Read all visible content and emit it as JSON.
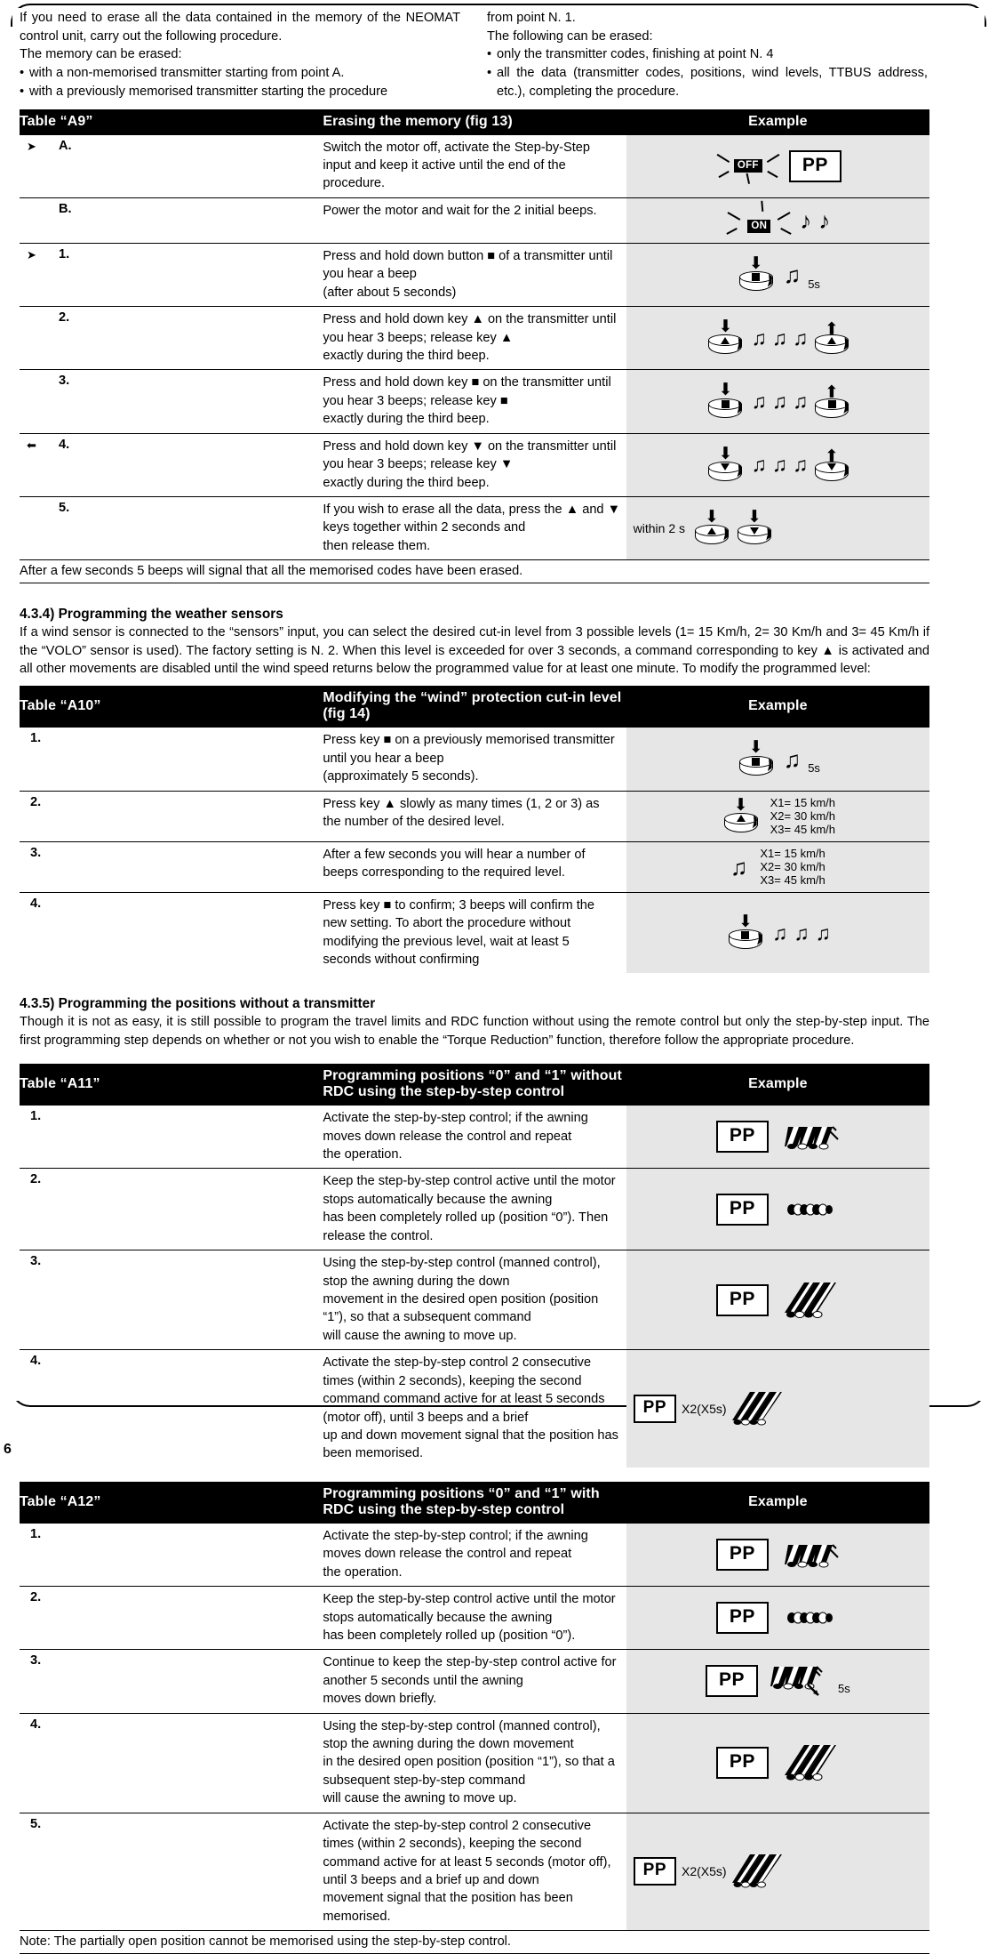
{
  "intro": {
    "left": {
      "p1": "If you need to erase all the data contained in the memory of the NEOMAT control unit, carry out the following procedure.",
      "p2": "The memory can be erased:",
      "b1": "with a non-memorised transmitter starting from point A.",
      "b2": "with a previously memorised transmitter starting the procedure"
    },
    "right": {
      "p1": "from point N. 1.",
      "p2": "The following can be erased:",
      "b1": "only the transmitter codes, finishing at point N. 4",
      "b2": "all the data (transmitter codes, positions, wind levels, TTBUS address, etc.), completing the procedure."
    }
  },
  "tableA9": {
    "label": "Table “A9”",
    "title": "Erasing the memory (fig 13)",
    "example": "Example",
    "rows": [
      {
        "num": "A.",
        "marker": "right",
        "desc": "Switch the motor off, activate the Step-by-Step input and keep it active until the end of the procedure.",
        "example": {
          "kind": "lamp-pp",
          "lamp": "OFF",
          "pp": "PP"
        }
      },
      {
        "num": "B.",
        "marker": "",
        "desc": "Power the motor and wait for the 2 initial beeps.",
        "example": {
          "kind": "lamp-beeps",
          "lamp": "ON",
          "beeps": 2
        }
      },
      {
        "num": "1.",
        "marker": "right",
        "desc": "Press and hold down button ■ of a transmitter until you hear a beep",
        "desc2": "(after about 5 seconds)",
        "example": {
          "kind": "btn-beeps",
          "glyph": "square",
          "beeps": 1,
          "note": "5s"
        }
      },
      {
        "num": "2.",
        "marker": "",
        "desc": "Press and hold down key ▲ on the transmitter until you hear 3 beeps; release key ▲",
        "desc2": "exactly during the third beep.",
        "example": {
          "kind": "btn-beeps-release",
          "glyph": "up",
          "beeps": 3,
          "release": "up"
        }
      },
      {
        "num": "3.",
        "marker": "",
        "desc": "Press and hold down key ■ on the transmitter until you hear 3 beeps; release key ■",
        "desc2": "exactly during the third beep.",
        "example": {
          "kind": "btn-beeps-release",
          "glyph": "square",
          "beeps": 3,
          "release": "square"
        }
      },
      {
        "num": "4.",
        "marker": "left",
        "desc": "Press and hold down key ▼ on the transmitter until you hear 3 beeps; release key ▼",
        "desc2": "exactly during the third beep.",
        "example": {
          "kind": "btn-beeps-release",
          "glyph": "down",
          "beeps": 3,
          "release": "down"
        }
      },
      {
        "num": "5.",
        "marker": "",
        "desc": "If you wish to erase all the data, press the  ▲ and ▼ keys together within 2 seconds and",
        "desc2": "then release them.",
        "example": {
          "kind": "two-buttons",
          "label": "within 2 s",
          "glyphs": [
            "up",
            "down"
          ]
        }
      }
    ],
    "footnote": "After a few seconds 5 beeps will signal that all the memorised codes have been erased."
  },
  "section434": {
    "heading": "4.3.4) Programming the weather sensors",
    "body": "If a wind sensor is connected to the “sensors” input, you can select the desired cut-in level from 3 possible levels (1= 15 Km/h, 2= 30 Km/h and 3= 45 Km/h if the “VOLO” sensor is used). The factory setting is N. 2. When this level is exceeded for over 3 seconds, a command corresponding to key ▲ is activated and all other movements are disabled until the wind speed returns below the programmed value for at least one minute. To modify the programmed level:"
  },
  "tableA10": {
    "label": "Table “A10”",
    "title": "Modifying the “wind” protection cut-in level  (fig 14)",
    "example": "Example",
    "levels": [
      "X1= 15 km/h",
      "X2= 30 km/h",
      "X3= 45 km/h"
    ],
    "rows": [
      {
        "num": "1.",
        "desc": "Press key ■ on a previously memorised transmitter until you hear a beep",
        "desc2": "(approximately 5 seconds).",
        "example": {
          "kind": "btn-beeps",
          "glyph": "square",
          "beeps": 1,
          "note": "5s"
        }
      },
      {
        "num": "2.",
        "desc": "Press key ▲ slowly as many times (1, 2 or 3) as the number of the desired level.",
        "desc2": "",
        "example": {
          "kind": "btn-levels",
          "glyph": "up"
        }
      },
      {
        "num": "3.",
        "desc": "After a few seconds you will hear a number of beeps corresponding to the required level.",
        "desc2": "",
        "example": {
          "kind": "beep-levels",
          "beeps": 1
        }
      },
      {
        "num": "4.",
        "desc": "Press key ■ to confirm; 3 beeps will confirm the new setting. To abort the procedure without",
        "desc2": "modifying the previous level, wait at least 5 seconds without confirming",
        "example": {
          "kind": "btn-beeps",
          "glyph": "square",
          "beeps": 3,
          "note": ""
        }
      }
    ]
  },
  "section435": {
    "heading": "4.3.5) Programming the positions without a transmitter",
    "body": "Though it is not as easy, it is still possible to program the travel limits and RDC function without using the remote control but only the step-by-step input. The first programming step depends on whether or not you wish to enable the “Torque Reduction” function, therefore follow the appropriate procedure."
  },
  "tableA11": {
    "label": "Table “A11”",
    "title": "Programming positions “0” and “1” without RDC  using the step-by-step control",
    "example": "Example",
    "rows": [
      {
        "num": "1.",
        "lines": [
          "Activate the step-by-step control; if the awning moves down release the control and repeat",
          "the operation."
        ],
        "example": {
          "kind": "pp-awning",
          "pp": "PP",
          "awning": "partly-rolled"
        }
      },
      {
        "num": "2.",
        "lines": [
          "Keep the step-by-step control active until the motor stops automatically because the awning",
          "has been completely rolled up (position “0”). Then release the control."
        ],
        "example": {
          "kind": "pp-awning",
          "pp": "PP",
          "awning": "rolled-up"
        }
      },
      {
        "num": "3.",
        "lines": [
          "Using the step-by-step control (manned control), stop the awning during the down",
          "movement in the desired open position (position “1”), so that a subsequent command",
          "will cause the awning to move up."
        ],
        "example": {
          "kind": "pp-awning",
          "pp": "PP",
          "awning": "open"
        }
      },
      {
        "num": "4.",
        "lines": [
          "Activate the step-by-step control 2 consecutive times (within 2 seconds), keeping the second",
          "command command active for at least 5 seconds (motor off), until 3 beeps and a brief",
          "up and down movement signal that the position has been memorised."
        ],
        "example": {
          "kind": "pp-x2-awning",
          "pp": "PP",
          "x2": "X2(X5s)",
          "awning": "open-arrows"
        }
      }
    ]
  },
  "tableA12": {
    "label": "Table “A12”",
    "title": "Programming positions “0” and “1” with RDC using the step-by-step control",
    "example": "Example",
    "rows": [
      {
        "num": "1.",
        "lines": [
          "Activate the step-by-step control; if the awning moves down release the control and repeat",
          "the operation."
        ],
        "example": {
          "kind": "pp-awning",
          "pp": "PP",
          "awning": "partly-rolled"
        }
      },
      {
        "num": "2.",
        "lines": [
          "Keep the step-by-step control active until the motor stops automatically because the awning",
          "has been completely rolled up (position “0”)."
        ],
        "example": {
          "kind": "pp-awning",
          "pp": "PP",
          "awning": "rolled-up"
        }
      },
      {
        "num": "3.",
        "lines": [
          "Continue to keep the step-by-step control active for another 5 seconds until the awning",
          "moves down briefly."
        ],
        "example": {
          "kind": "pp-awning-5s",
          "pp": "PP",
          "awning": "partly-arrow",
          "note": "5s"
        }
      },
      {
        "num": "4.",
        "lines": [
          "Using the step-by-step control (manned control), stop the awning during the down movement",
          "in the desired open position (position “1”), so that a subsequent step-by-step command",
          "will cause the awning to move up."
        ],
        "example": {
          "kind": "pp-awning",
          "pp": "PP",
          "awning": "open"
        }
      },
      {
        "num": "5.",
        "lines": [
          "Activate the step-by-step control 2 consecutive times (within 2 seconds), keeping the second",
          "command active for at least 5 seconds (motor off), until 3 beeps and a brief up and down",
          "movement signal that the position has been memorised."
        ],
        "example": {
          "kind": "pp-x2-awning",
          "pp": "PP",
          "x2": "X2(X5s)",
          "awning": "open-arrows"
        }
      }
    ],
    "note": "Note: The partially open position cannot be memorised using the step-by-step control."
  },
  "page_number": "6"
}
